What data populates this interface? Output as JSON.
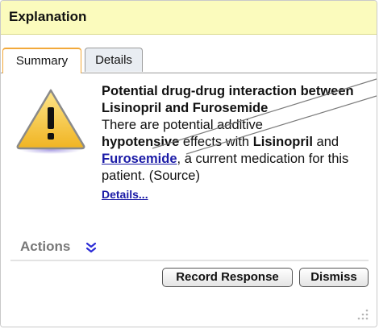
{
  "header": {
    "title": "Explanation"
  },
  "tabs": [
    {
      "label": "Summary",
      "active": true
    },
    {
      "label": "Details",
      "active": false
    }
  ],
  "alert": {
    "icon": "warning-icon",
    "title": "Potential drug-drug interaction between Lisinopril and Furosemide",
    "text_1": "There are potential additive",
    "text_bold_1": "hypotensive",
    "text_2": " effects with ",
    "drug": "Lisinopril",
    "text_3": " and",
    "current_med_link": "Furosemide",
    "text_4": ", a current medication for this patient. (Source)",
    "details_link": "Details..."
  },
  "actions": {
    "label": "Actions",
    "toggle_icon": "double-chevron-down-icon"
  },
  "buttons": {
    "record_response": "Record Response",
    "dismiss": "Dismiss"
  },
  "colors": {
    "header_bg": "#fbfbbd",
    "active_tab_accent": "#f2a93b",
    "link": "#1a1aa6",
    "warning_fill": "#f7c948"
  }
}
